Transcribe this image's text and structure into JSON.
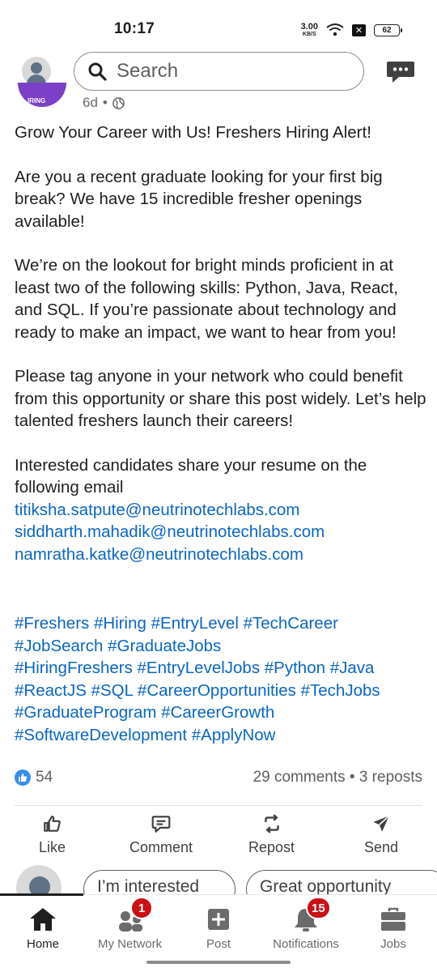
{
  "status_bar": {
    "time": "10:17",
    "net_speed_value": "3.00",
    "net_speed_unit": "KB/S",
    "battery": "62",
    "icons": [
      "wifi-icon",
      "close-box-icon",
      "battery-icon"
    ]
  },
  "top_bar": {
    "search_placeholder": "Search",
    "icons": [
      "avatar",
      "search-icon",
      "messaging-icon"
    ]
  },
  "post": {
    "author_logo_text": "IRING",
    "age": "6d",
    "visibility_separator": "•",
    "headline": "Grow Your Career with Us! Freshers Hiring Alert!",
    "para1": "Are you a recent graduate looking for your first big break? We have 15 incredible fresher openings available!",
    "para2": "We’re on the lookout for bright minds proficient in at least two of the following skills: Python, Java, React, and SQL. If you’re passionate about technology and ready to make an impact, we want to hear from you!",
    "para3": "Please tag anyone in your network who could benefit from this opportunity or share this post widely. Let’s help talented freshers launch their careers!",
    "para4": "Interested candidates share your resume on the following email",
    "emails": [
      "titiksha.satpute@neutrinotechlabs.com",
      "siddharth.mahadik@neutrinotechlabs.com",
      "namratha.katke@neutrinotechlabs.com"
    ],
    "hashtags": [
      "#Freshers #Hiring #EntryLevel #TechCareer",
      "#JobSearch #GraduateJobs",
      "#HiringFreshers #EntryLevelJobs #Python #Java",
      "#ReactJS #SQL #CareerOpportunities #TechJobs",
      "#GraduateProgram #CareerGrowth",
      "#SoftwareDevelopment #ApplyNow"
    ],
    "reactions_count": "54",
    "comments_reposts": "29 comments • 3 reposts"
  },
  "actions": {
    "like": "Like",
    "comment": "Comment",
    "repost": "Repost",
    "send": "Send"
  },
  "suggestions": {
    "chip1": "I’m interested",
    "chip2": "Great opportunity"
  },
  "bottom_nav": {
    "home": "Home",
    "network": "My Network",
    "network_badge": "1",
    "post": "Post",
    "notifications": "Notifications",
    "notifications_badge": "15",
    "jobs": "Jobs"
  },
  "colors": {
    "link": "#0a66c2",
    "badge": "#cc1016",
    "reaction": "#378fe9"
  }
}
